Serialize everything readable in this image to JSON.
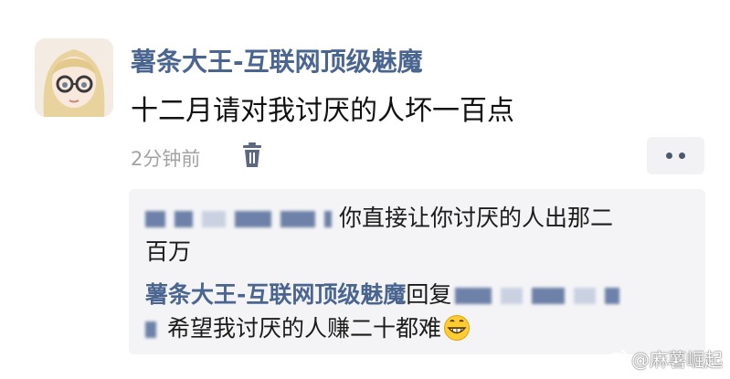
{
  "post": {
    "username": "薯条大王-互联网顶级魅魔",
    "text": "十二月请对我讨厌的人坏一百点",
    "timestamp": "2分钟前"
  },
  "icons": {
    "delete": "trash-icon",
    "more": "more-dots-icon",
    "emoji": "grinning-face-emoji",
    "watermark": "weibo-logo-icon"
  },
  "comments": [
    {
      "text_line1": "你直接让你讨厌的人出那二",
      "text_line2": "百万"
    },
    {
      "author": "薯条大王-互联网顶级魅魔",
      "reply_word": "回复",
      "text": "希望我讨厌的人赚二十都难"
    }
  ],
  "watermark": {
    "text": "@麻薯崛起"
  },
  "colors": {
    "username": "#4a6690",
    "text": "#111111",
    "meta": "#a3a3a3",
    "comment_bg": "#f4f4f6"
  }
}
